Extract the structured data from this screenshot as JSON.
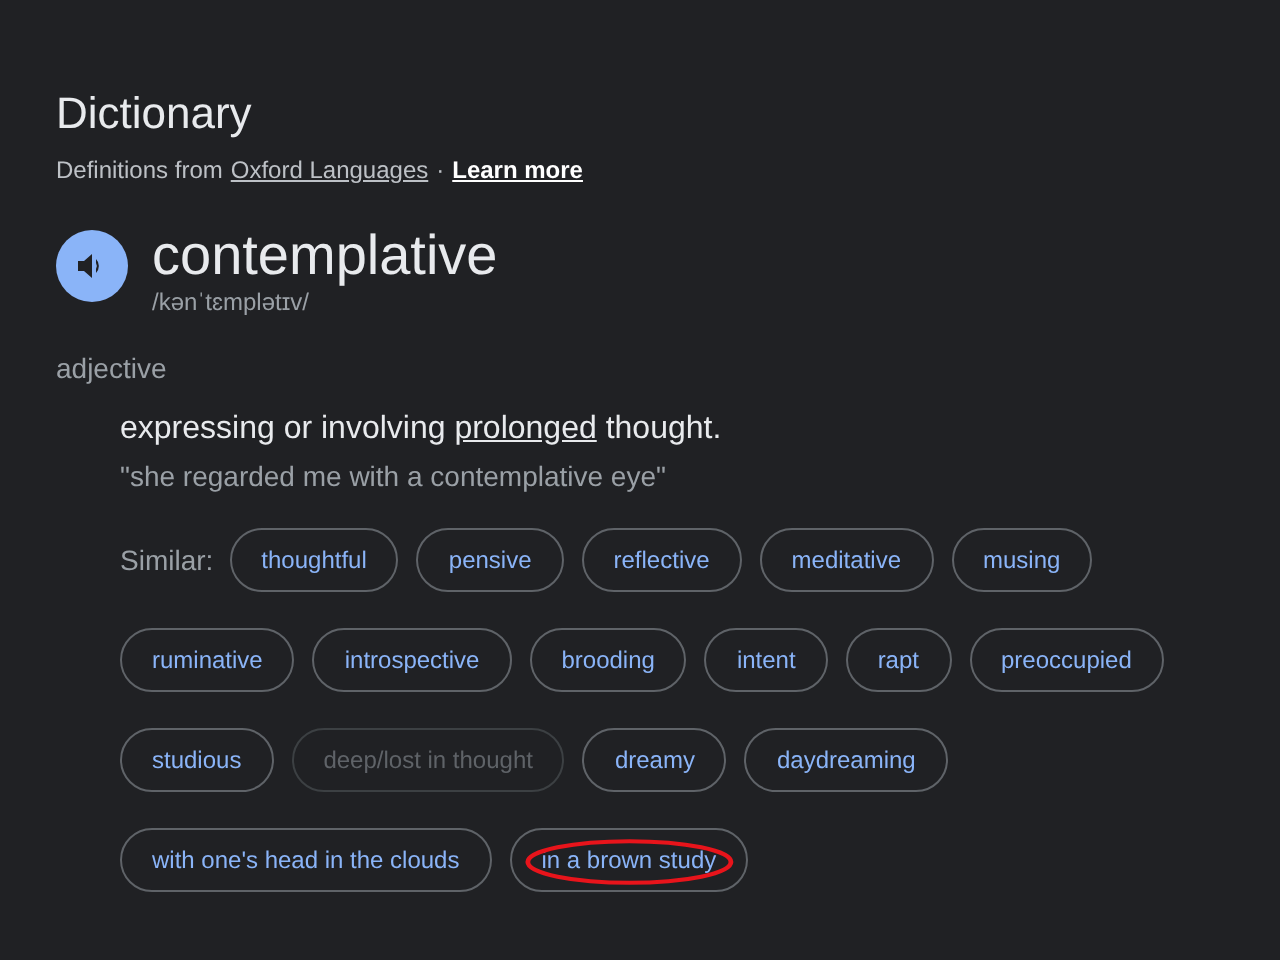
{
  "heading": "Dictionary",
  "source": {
    "prefix": "Definitions from",
    "link": "Oxford Languages",
    "separator": "·",
    "learn_more": "Learn more"
  },
  "entry": {
    "word": "contemplative",
    "pronunciation": "/kənˈtɛmplətɪv/",
    "part_of_speech": "adjective"
  },
  "definition": {
    "text": "expressing or involving",
    "link": "prolonged",
    "rest": "thought.",
    "example": "\"she regarded me with a contemplative eye\""
  },
  "similar_label": "Similar:",
  "similar_rows": [
    [
      {
        "label": "thoughtful",
        "disabled": false,
        "circled": false
      },
      {
        "label": "pensive",
        "disabled": false,
        "circled": false
      },
      {
        "label": "reflective",
        "disabled": false,
        "circled": false
      },
      {
        "label": "meditative",
        "disabled": false,
        "circled": false
      },
      {
        "label": "musing",
        "disabled": false,
        "circled": false
      }
    ],
    [
      {
        "label": "ruminative",
        "disabled": false,
        "circled": false
      },
      {
        "label": "introspective",
        "disabled": false,
        "circled": false
      },
      {
        "label": "brooding",
        "disabled": false,
        "circled": false
      },
      {
        "label": "intent",
        "disabled": false,
        "circled": false
      },
      {
        "label": "rapt",
        "disabled": false,
        "circled": false
      },
      {
        "label": "preoccupied",
        "disabled": false,
        "circled": false
      }
    ],
    [
      {
        "label": "studious",
        "disabled": false,
        "circled": false
      },
      {
        "label": "deep/lost in thought",
        "disabled": true,
        "circled": false
      },
      {
        "label": "dreamy",
        "disabled": false,
        "circled": false
      },
      {
        "label": "daydreaming",
        "disabled": false,
        "circled": false
      }
    ],
    [
      {
        "label": "with one's head in the clouds",
        "disabled": false,
        "circled": false
      },
      {
        "label": "in a brown study",
        "disabled": false,
        "circled": true
      }
    ]
  ]
}
